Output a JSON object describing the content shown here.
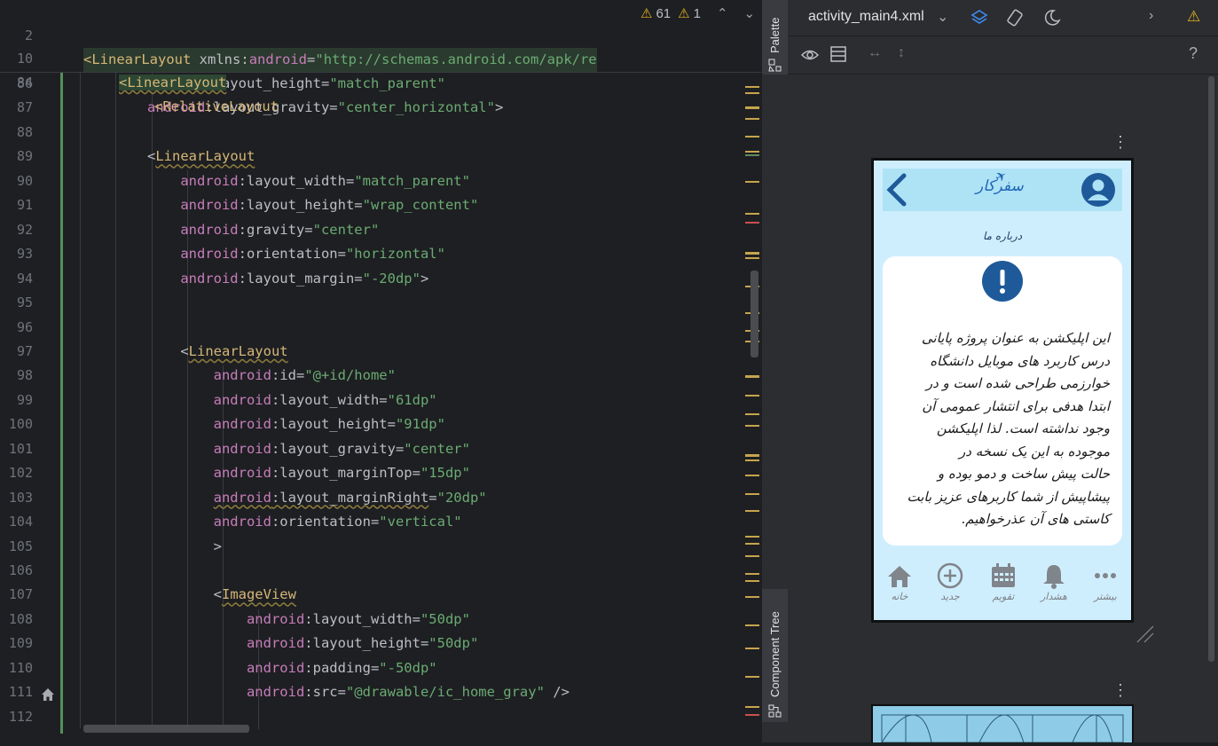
{
  "editor": {
    "sticky_lines": [
      {
        "num": "2",
        "indent": "",
        "tag": "<LinearLayout",
        "rest": " xmlns:android=\"http://schemas.android.com/apk/re"
      },
      {
        "num": "10",
        "indent": "    ",
        "tag": "<LinearLayout",
        "rest": ""
      },
      {
        "num": "84",
        "indent": "        ",
        "tag": "<RelativeLayout",
        "rest": ""
      }
    ],
    "inspection": {
      "warnings": "61",
      "weak_warnings": "1"
    },
    "lines": [
      {
        "num": "86",
        "text": "            android:layout_height=\"match_parent\""
      },
      {
        "num": "87",
        "text": "            android:layout_gravity=\"center_horizontal\">"
      },
      {
        "num": "88",
        "text": ""
      },
      {
        "num": "89",
        "text": "            <LinearLayout"
      },
      {
        "num": "90",
        "text": "                android:layout_width=\"match_parent\""
      },
      {
        "num": "91",
        "text": "                android:layout_height=\"wrap_content\""
      },
      {
        "num": "92",
        "text": "                android:gravity=\"center\""
      },
      {
        "num": "93",
        "text": "                android:orientation=\"horizontal\""
      },
      {
        "num": "94",
        "text": "                android:layout_margin=\"-20dp\">"
      },
      {
        "num": "95",
        "text": ""
      },
      {
        "num": "96",
        "text": ""
      },
      {
        "num": "97",
        "text": "                <LinearLayout"
      },
      {
        "num": "98",
        "text": "                    android:id=\"@+id/home\""
      },
      {
        "num": "99",
        "text": "                    android:layout_width=\"61dp\""
      },
      {
        "num": "100",
        "text": "                    android:layout_height=\"91dp\""
      },
      {
        "num": "101",
        "text": "                    android:layout_gravity=\"center\""
      },
      {
        "num": "102",
        "text": "                    android:layout_marginTop=\"15dp\""
      },
      {
        "num": "103",
        "text": "                    android:layout_marginRight=\"20dp\""
      },
      {
        "num": "104",
        "text": "                    android:orientation=\"vertical\""
      },
      {
        "num": "105",
        "text": "                    >"
      },
      {
        "num": "106",
        "text": ""
      },
      {
        "num": "107",
        "text": "                    <ImageView"
      },
      {
        "num": "108",
        "text": "                        android:layout_width=\"50dp\""
      },
      {
        "num": "109",
        "text": "                        android:layout_height=\"50dp\""
      },
      {
        "num": "110",
        "text": "                        android:padding=\"-50dp\""
      },
      {
        "num": "111",
        "text": "                        android:src=\"@drawable/ic_home_gray\" />"
      },
      {
        "num": "112",
        "text": ""
      }
    ]
  },
  "sidebar": {
    "palette_label": "Palette",
    "component_tree_label": "Component Tree"
  },
  "design": {
    "file_name": "activity_main4.xml",
    "help": "?",
    "app": {
      "logo_text": "سفرکار",
      "title": "درباره ما",
      "about_lines": [
        "این اپلیکشن به عنوان پروژه پایانی",
        "درس کاربرد های موبایل دانشگاه",
        "خوارزمی طراحی شده است و در",
        "ابتدا هدفی برای انتشار عمومی آن",
        "وجود نداشته است. لذا اپلیکشن",
        "موجوده به این یک نسخه در",
        "حالت پیش ساخت و دمو بوده و",
        "پیشاپیش از شما کاربرهای عزیز بابت",
        "کاستی های آن عذرخواهیم."
      ],
      "nav": [
        "خانه",
        "جدید",
        "تقویم",
        "هشدار",
        "بیشتر"
      ]
    }
  }
}
